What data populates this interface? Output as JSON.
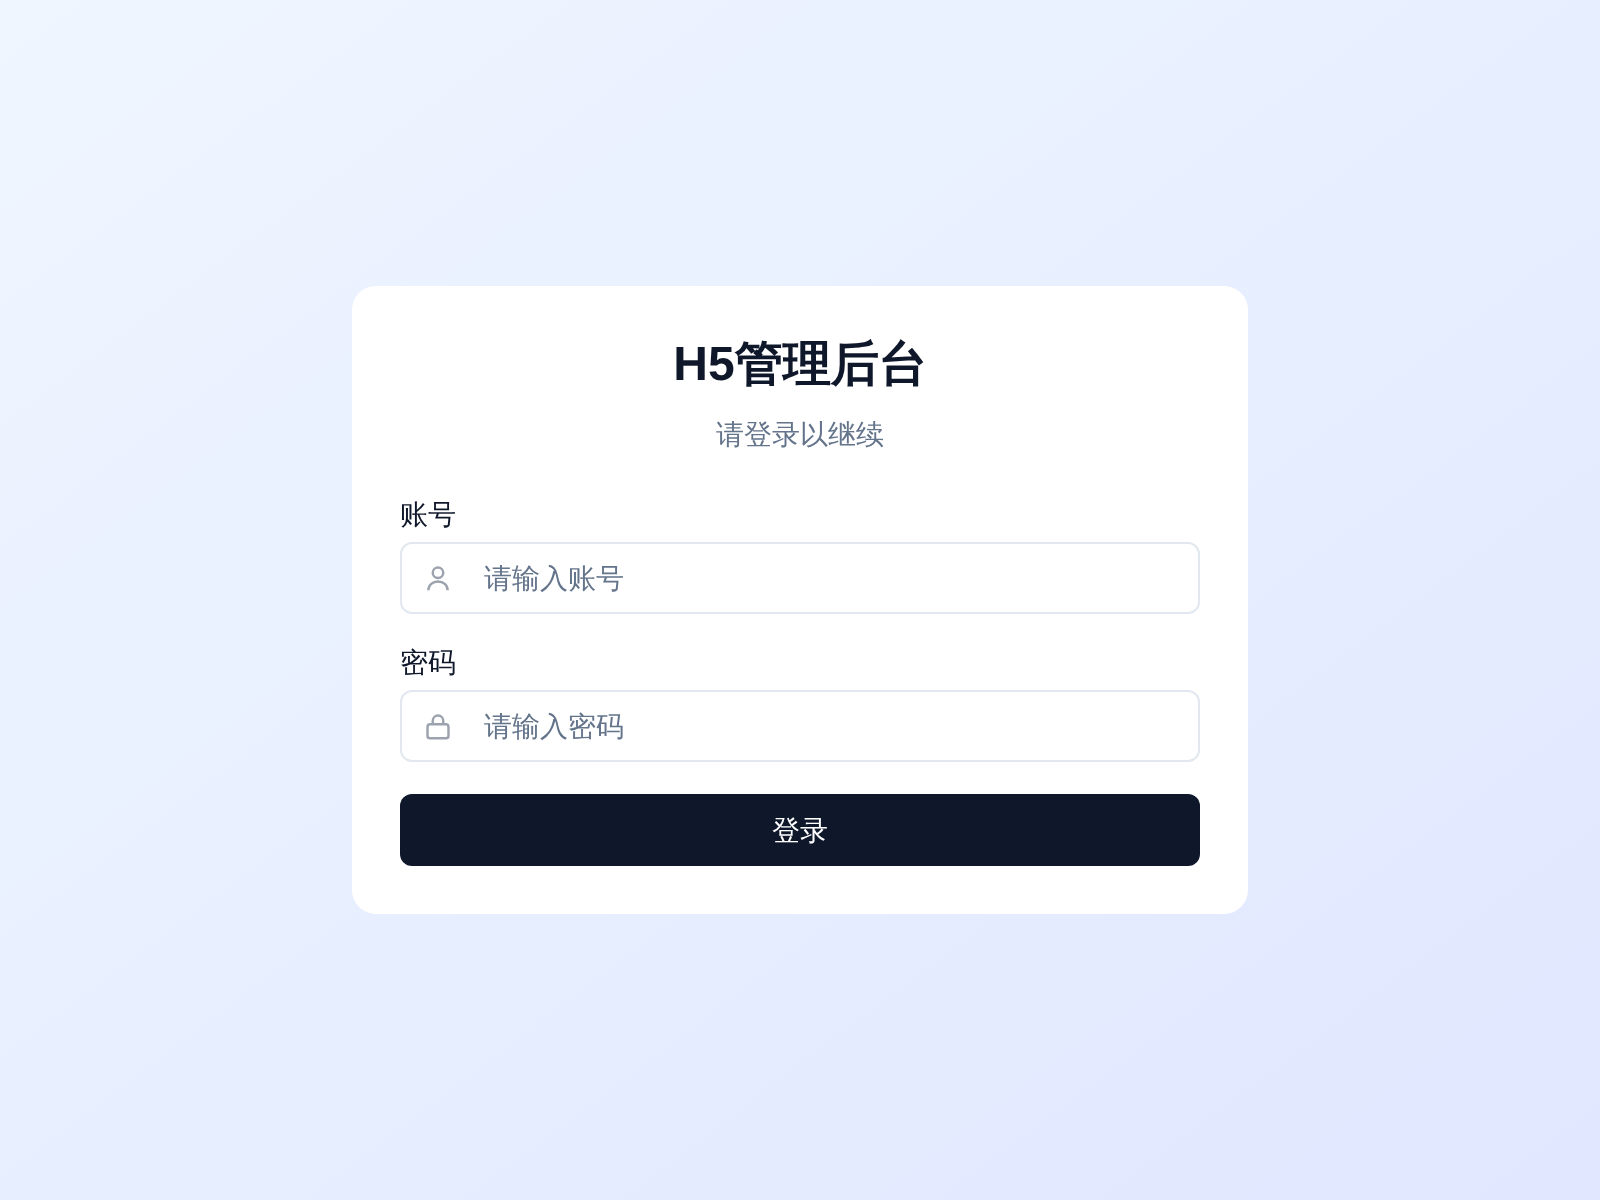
{
  "title": "H5管理后台",
  "subtitle": "请登录以继续",
  "fields": [
    {
      "kind": "user",
      "label": "账号",
      "placeholder": "请输入账号"
    },
    {
      "kind": "password",
      "label": "密码",
      "placeholder": "请输入密码"
    }
  ],
  "submit": "登录"
}
